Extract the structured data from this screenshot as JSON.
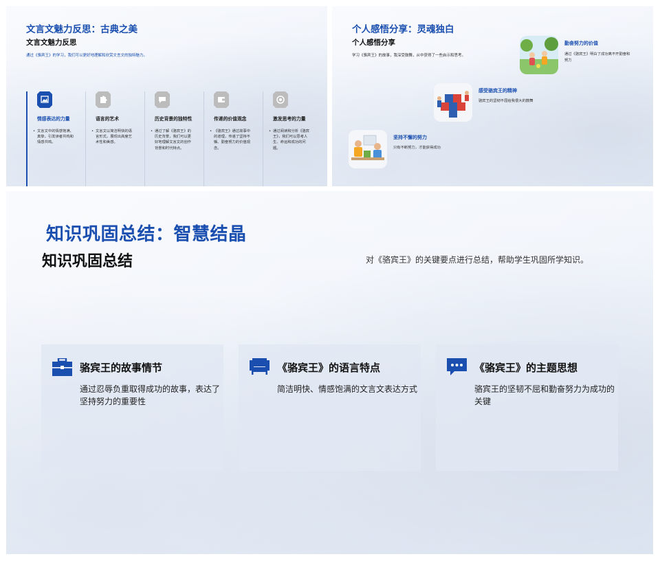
{
  "slide1": {
    "title": "文言文魅力反思：古典之美",
    "subtitle": "文言文魅力反思",
    "desc": "通过《骆宾王》的学习，我们可以更好地理解和欣赏文言文的独特魅力。",
    "columns": [
      {
        "title": "情感表达的力量",
        "body": "文言文中的情感饱满、真挚，引发读者共鸣和情感共鸣。",
        "icon": "image-icon"
      },
      {
        "title": "语言的艺术",
        "body": "文言文以简洁明快的语言形式，展现出高度艺术性和美感。",
        "icon": "puzzle-icon"
      },
      {
        "title": "历史背景的独特性",
        "body": "通过了解《骆宾王》的历史背景，我们可以更好地理解文言文的创作背景和时代特点。",
        "icon": "chat-icon"
      },
      {
        "title": "传递的价值观念",
        "body": "《骆宾王》通过故事中的道理，传递了坚持不懈、勤奋努力的价值观念。",
        "icon": "wallet-icon"
      },
      {
        "title": "激发思考的力量",
        "body": "通过阅读和分析《骆宾王》，我们可以思考人生、命运和成功的问题。",
        "icon": "target-icon"
      }
    ]
  },
  "slide2": {
    "title": "个人感悟分享：灵魂独白",
    "subtitle": "个人感悟分享",
    "desc": "学习《骆宾王》的故事，我深受鼓舞，从中获得了一些启示和思考。",
    "items": [
      {
        "title": "勤奋努力的价值",
        "body": "通过《骆宾王》明白了成功离不开勤奋和努力"
      },
      {
        "title": "感受骆宾王的精神",
        "body": "骆宾王的坚韧不屈给我很大的鼓舞"
      },
      {
        "title": "坚持不懈的努力",
        "body": "只有不断努力，才能获得成功"
      }
    ]
  },
  "slide3": {
    "title": "知识巩固总结：智慧结晶",
    "subtitle": "知识巩固总结",
    "desc": "对《骆宾王》的关键要点进行总结，帮助学生巩固所学知识。",
    "cards": [
      {
        "title": "骆宾王的故事情节",
        "body": "通过忍辱负重取得成功的故事，表达了坚持努力的重要性",
        "icon": "briefcase-icon"
      },
      {
        "title": "《骆宾王》的语言特点",
        "body": "简洁明快、情感饱满的文言文表达方式",
        "icon": "sofa-icon"
      },
      {
        "title": "《骆宾王》的主题思想",
        "body": "骆宾王的坚韧不屈和勤奋努力为成功的关键",
        "icon": "chat-bubble-icon"
      }
    ]
  },
  "colors": {
    "accent": "#1a4fb0",
    "inactive_icon": "#bcbcbc"
  }
}
